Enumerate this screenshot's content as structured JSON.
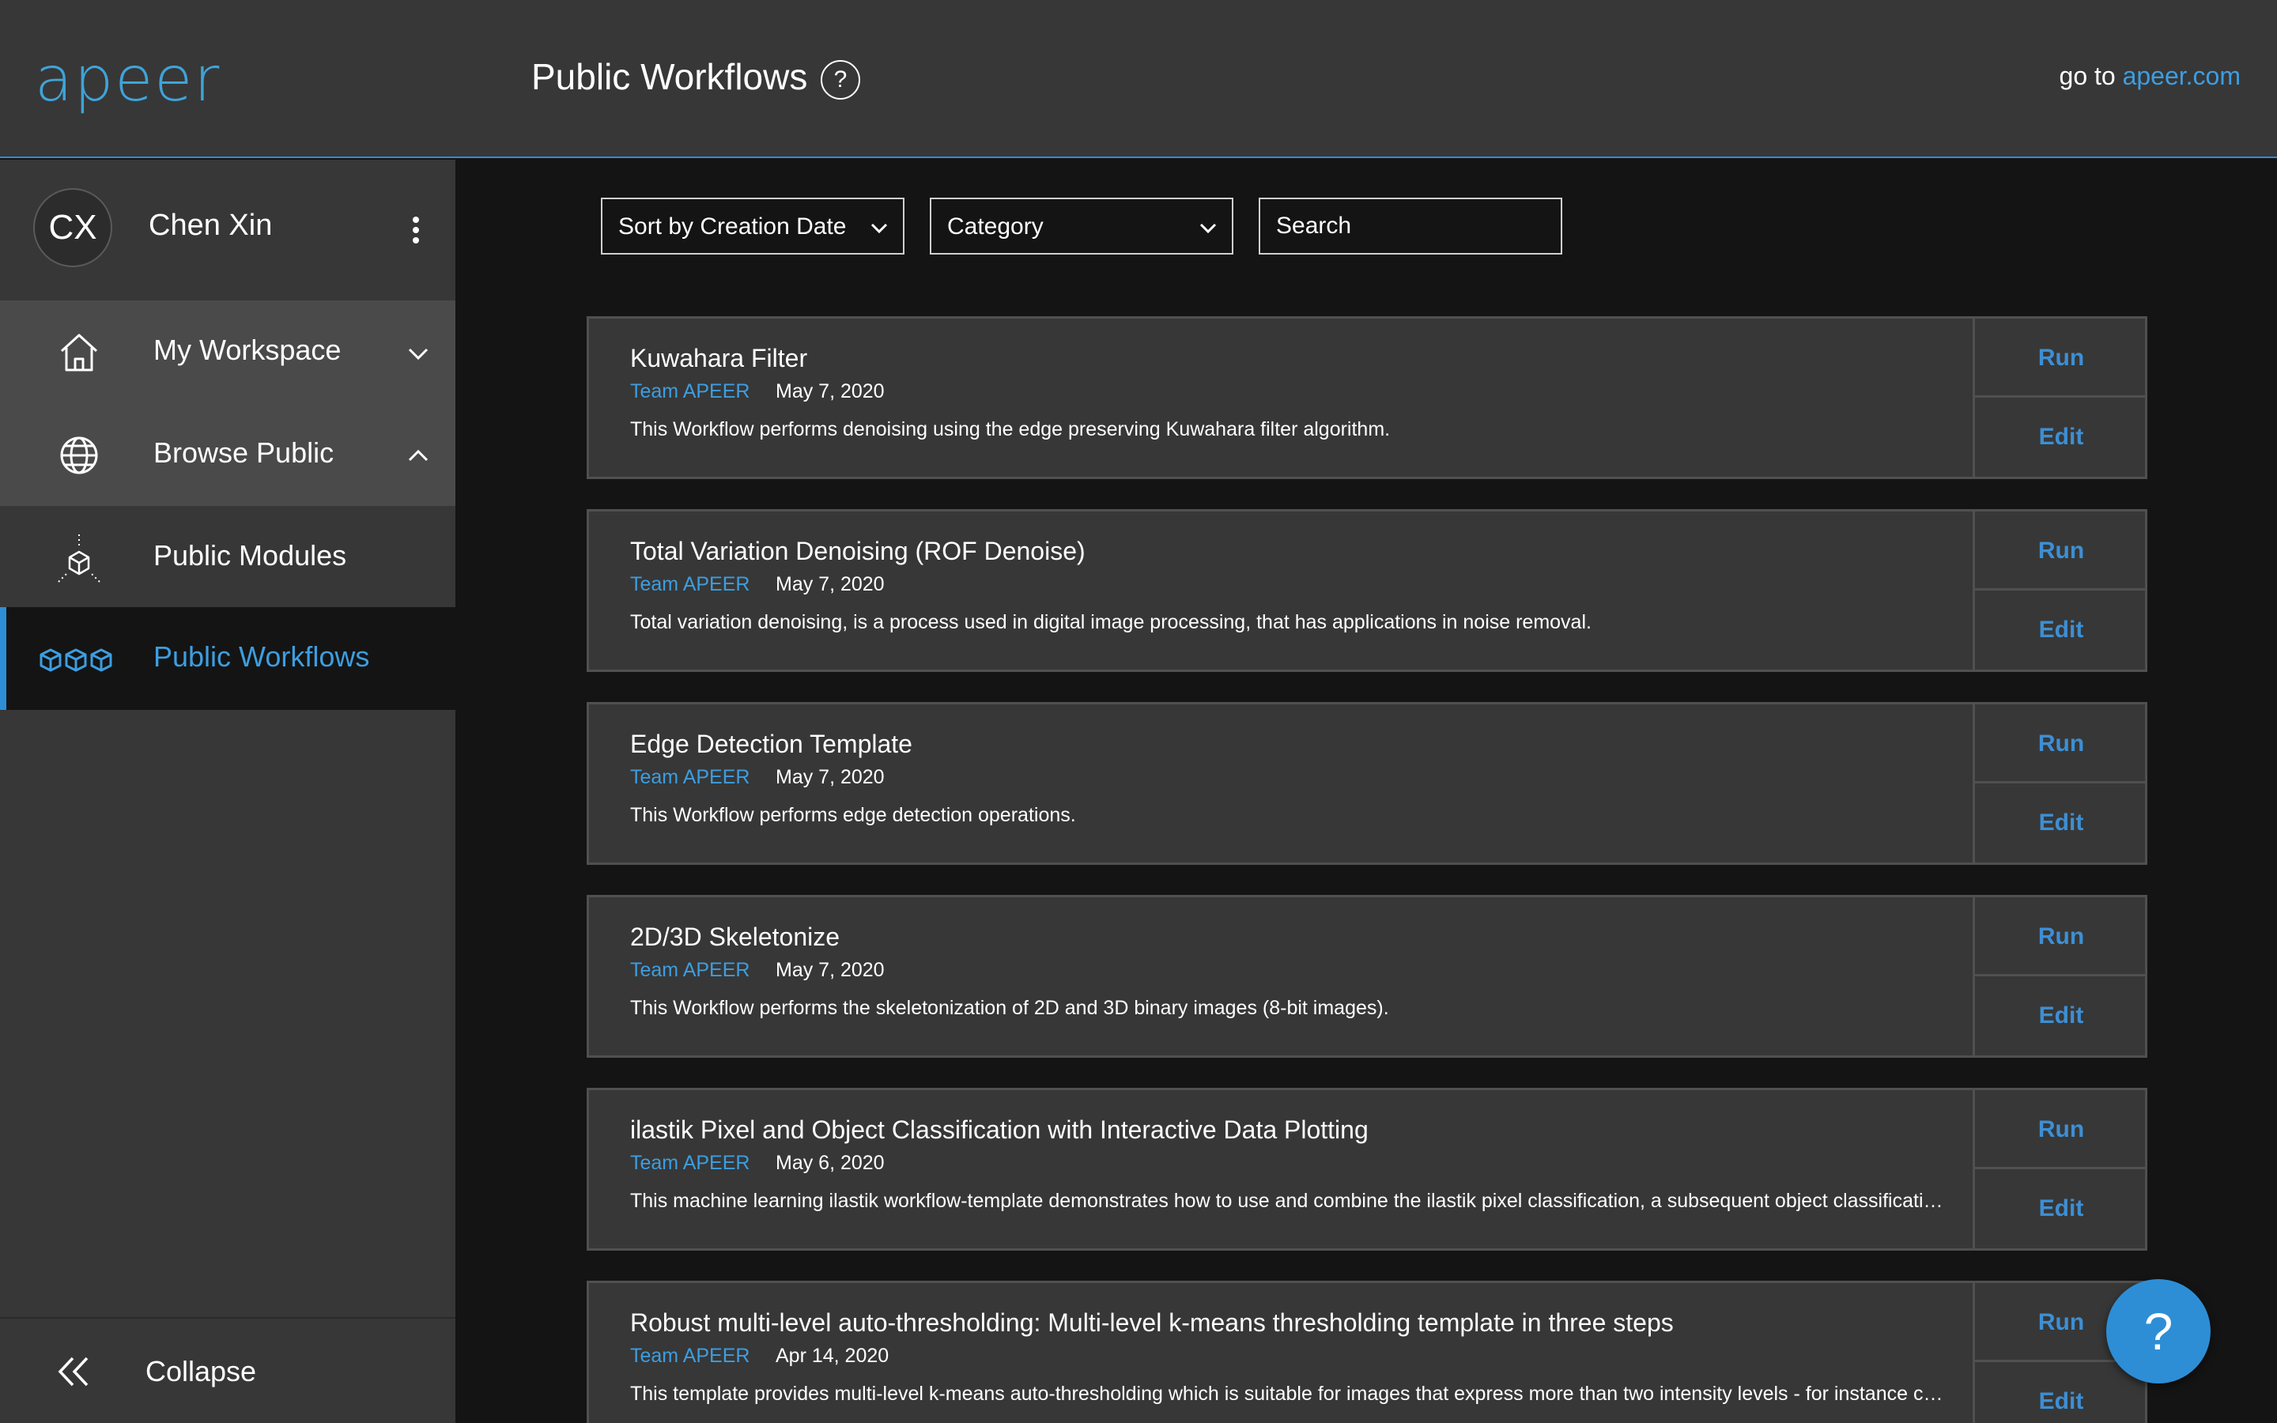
{
  "header": {
    "logo": "apeer",
    "title": "Public Workflows",
    "help": "?",
    "goto_prefix": "go to ",
    "goto_link": "apeer.com"
  },
  "user": {
    "initials": "CX",
    "name": "Chen Xin"
  },
  "nav": {
    "workspace": "My Workspace",
    "browse": "Browse Public",
    "modules": "Public Modules",
    "workflows": "Public Workflows",
    "collapse": "Collapse"
  },
  "filters": {
    "sort": "Sort by Creation Date",
    "category": "Category",
    "search_placeholder": "Search"
  },
  "workflows": [
    {
      "title": "Kuwahara Filter",
      "author": "Team APEER",
      "date": "May 7, 2020",
      "description": "This Workflow performs denoising using the edge preserving Kuwahara filter algorithm.",
      "run": "Run",
      "edit": "Edit"
    },
    {
      "title": "Total Variation Denoising (ROF Denoise)",
      "author": "Team APEER",
      "date": "May 7, 2020",
      "description": "Total variation denoising, is a process used in digital image processing, that has applications in noise removal.",
      "run": "Run",
      "edit": "Edit"
    },
    {
      "title": "Edge Detection Template",
      "author": "Team APEER",
      "date": "May 7, 2020",
      "description": "This Workflow performs edge detection operations.",
      "run": "Run",
      "edit": "Edit"
    },
    {
      "title": "2D/3D Skeletonize",
      "author": "Team APEER",
      "date": "May 7, 2020",
      "description": "This Workflow performs the skeletonization of 2D and 3D binary images (8-bit images).",
      "run": "Run",
      "edit": "Edit"
    },
    {
      "title": "ilastik Pixel and Object Classification with Interactive Data Plotting",
      "author": "Team APEER",
      "date": "May 6, 2020",
      "description": "This machine learning ilastik workflow-template demonstrates how to use and combine the ilastik pixel classification, a subsequent object classificati…",
      "run": "Run",
      "edit": "Edit"
    },
    {
      "title": "Robust multi-level auto-thresholding: Multi-level k-means thresholding template in three steps",
      "author": "Team APEER",
      "date": "Apr 14, 2020",
      "description": "This template provides multi-level k-means auto-thresholding which is suitable for images that express more than two intensity levels - for instance c…",
      "run": "Run",
      "edit": "Edit"
    }
  ],
  "fab": "?",
  "colors": {
    "accent": "#2d8ed6",
    "link": "#3d9ee0",
    "header_bg": "#373737",
    "page_bg": "#141414",
    "card_bg": "#373737"
  }
}
